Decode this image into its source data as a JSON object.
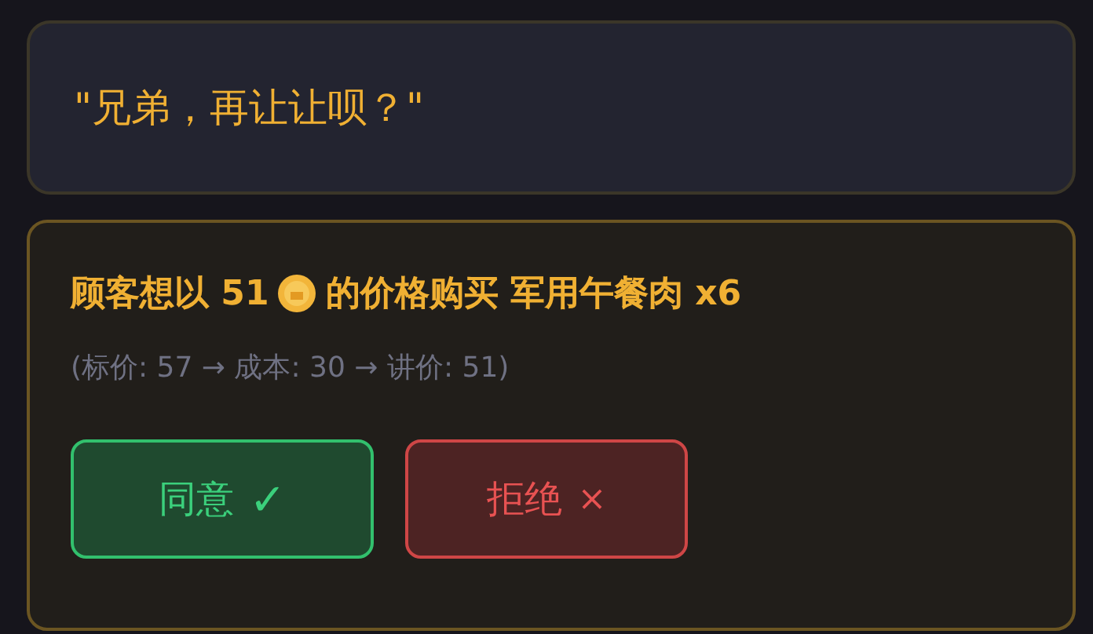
{
  "dialogue": {
    "quote": "\"兄弟，再让让呗？\""
  },
  "offer": {
    "title_before": "顾客想以 51",
    "title_after": "的价格购买 军用午餐肉 x6",
    "detail": "(标价: 57 → 成本: 30 → 讲价: 51)",
    "buttons": [
      {
        "kind": "accept",
        "label": "同意",
        "icon": "✓"
      },
      {
        "kind": "reject",
        "label": "拒绝",
        "icon": "×"
      }
    ]
  }
}
